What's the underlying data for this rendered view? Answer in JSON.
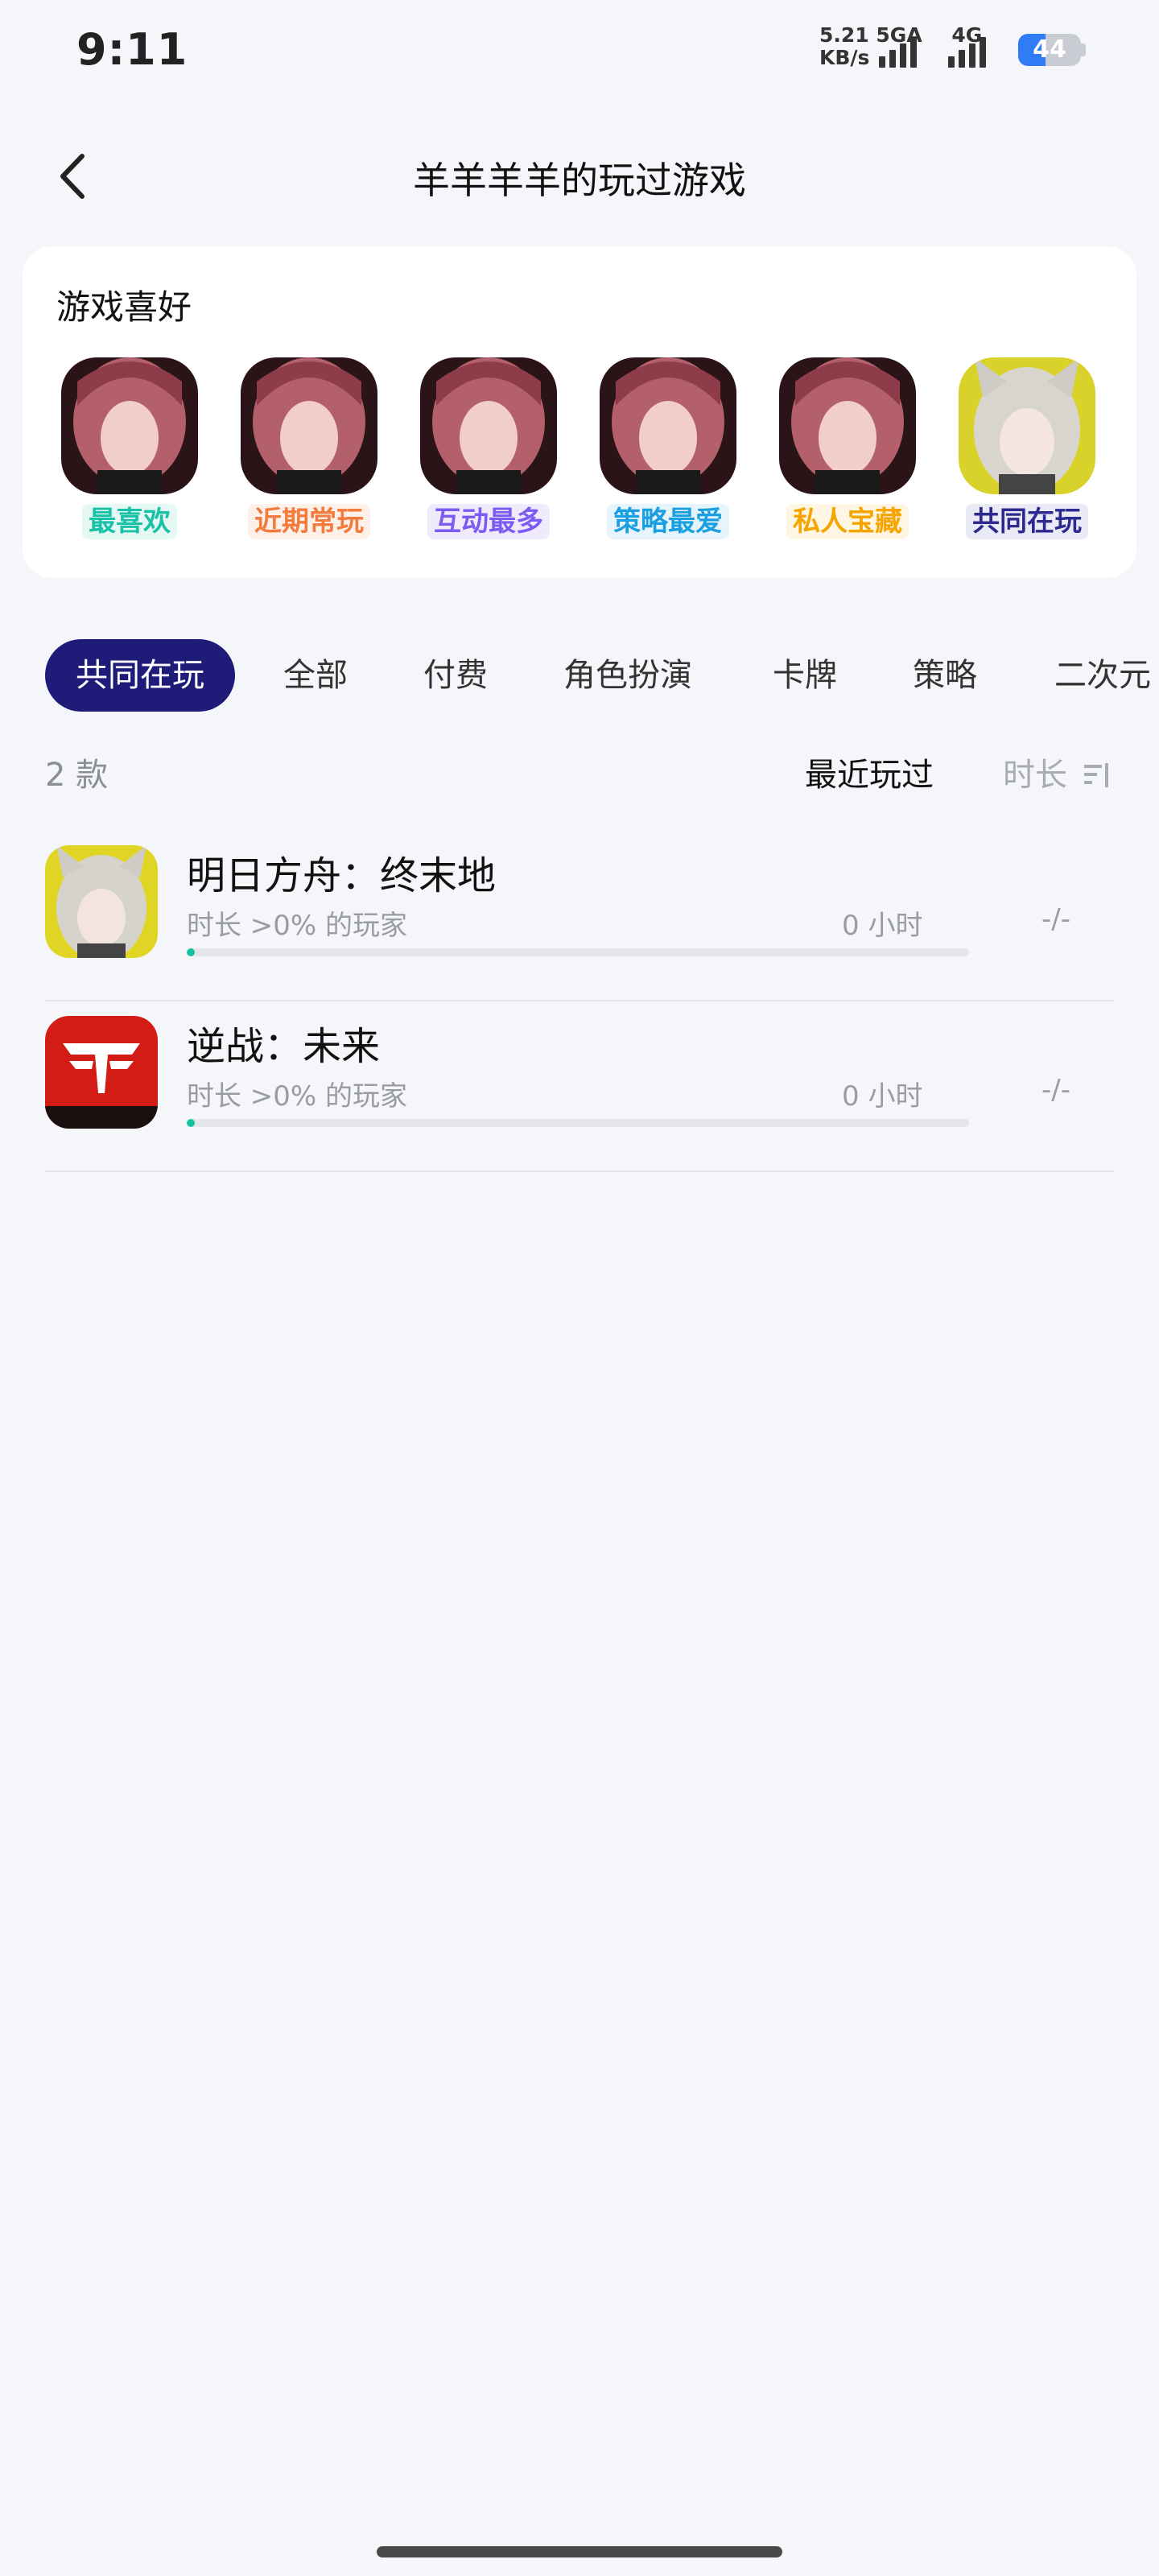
{
  "status_bar": {
    "time": "9:11",
    "net_speed": "5.21",
    "net_unit": "KB/s",
    "net_type_1": "5GA",
    "net_type_2": "4G",
    "battery": "44"
  },
  "header": {
    "back_icon": "chevron-left-icon",
    "title": "羊羊羊羊的玩过游戏"
  },
  "preferences": {
    "title": "游戏喜好",
    "items": [
      {
        "label": "最喜欢",
        "color": "#19c2a6",
        "bg": "#e6f8f4",
        "icon": "character-avatar-red-hair"
      },
      {
        "label": "近期常玩",
        "color": "#f27b3d",
        "bg": "#fdf0e8",
        "icon": "character-avatar-red-hair"
      },
      {
        "label": "互动最多",
        "color": "#7a5cf0",
        "bg": "#efebfd",
        "icon": "character-avatar-red-hair"
      },
      {
        "label": "策略最爱",
        "color": "#1aa0e0",
        "bg": "#e7f4fc",
        "icon": "character-avatar-red-hair"
      },
      {
        "label": "私人宝藏",
        "color": "#f5a400",
        "bg": "#fef6e2",
        "icon": "character-avatar-red-hair"
      },
      {
        "label": "共同在玩",
        "color": "#2d2a8f",
        "bg": "#eaeaf6",
        "icon": "character-avatar-white-hair"
      }
    ]
  },
  "filters": {
    "tabs": [
      "共同在玩",
      "全部",
      "付费",
      "角色扮演",
      "卡牌",
      "策略",
      "二次元"
    ],
    "active": "共同在玩"
  },
  "list_header": {
    "count": "2 款",
    "sort_recent": "最近玩过",
    "sort_duration": "时长",
    "sort_icon": "sort-icon"
  },
  "games": [
    {
      "name": "明日方舟：终末地",
      "subtitle": "时长 >0% 的玩家",
      "hours": "0 小时",
      "ratio": "-/-",
      "progress": 0.0,
      "icon": "arknights-endfield-icon"
    },
    {
      "name": "逆战：未来",
      "subtitle": "时长 >0% 的玩家",
      "hours": "0 小时",
      "ratio": "-/-",
      "progress": 0.0,
      "icon": "nizhan-future-icon"
    }
  ]
}
